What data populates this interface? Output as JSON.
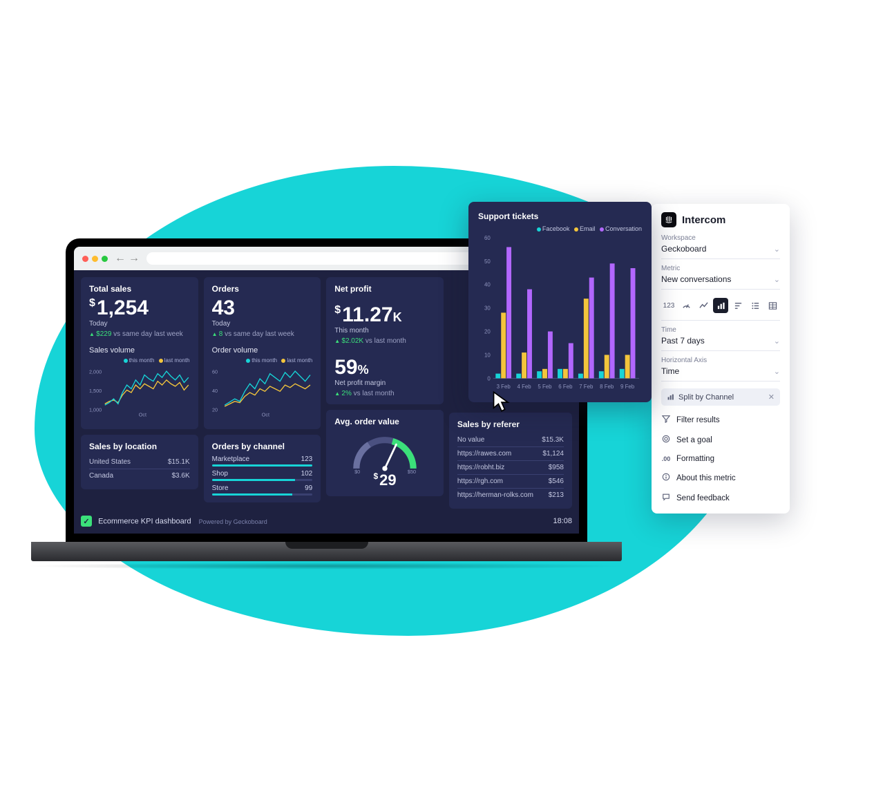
{
  "dashboard": {
    "title": "Ecommerce KPI dashboard",
    "powered_by": "Powered by Geckoboard",
    "clock": "18:08"
  },
  "total_sales": {
    "title": "Total sales",
    "currency": "$",
    "value": "1,254",
    "period": "Today",
    "delta_val": "$229",
    "delta_txt": "vs same day last week",
    "sub_title": "Sales volume",
    "ymax": "2,000",
    "ymid": "1,500",
    "ymin": "1,000",
    "xlabel": "Oct",
    "legend_a": "this month",
    "legend_b": "last month"
  },
  "orders": {
    "title": "Orders",
    "value": "43",
    "period": "Today",
    "delta_val": "8",
    "delta_txt": "vs same day last week",
    "sub_title": "Order volume",
    "ymax": "60",
    "ymid": "40",
    "ymin": "20",
    "xlabel": "Oct",
    "legend_a": "this month",
    "legend_b": "last month",
    "channels_title": "Orders by channel",
    "channels": [
      {
        "label": "Marketplace",
        "value": "123",
        "pct": 100
      },
      {
        "label": "Shop",
        "value": "102",
        "pct": 83
      },
      {
        "label": "Store",
        "value": "99",
        "pct": 80
      }
    ]
  },
  "net_profit": {
    "title": "Net profit",
    "currency": "$",
    "value": "11.27",
    "suffix": "K",
    "period": "This month",
    "delta_val": "$2.02K",
    "delta_txt": "vs last month",
    "margin_value": "59",
    "margin_suffix": "%",
    "margin_label": "Net profit margin",
    "margin_delta_val": "2%",
    "margin_delta_txt": "vs last month"
  },
  "avg_order": {
    "title": "Avg. order value",
    "min": "$0",
    "max": "$50",
    "currency": "$",
    "value": "29"
  },
  "sales_by_location": {
    "title": "Sales by location",
    "rows": [
      {
        "label": "United States",
        "value": "$15.1K"
      },
      {
        "label": "Canada",
        "value": "$3.6K"
      }
    ]
  },
  "sales_by_referer": {
    "title": "Sales by referer",
    "rows": [
      {
        "label": "No value",
        "value": "$15.3K"
      },
      {
        "label": "https://rawes.com",
        "value": "$1,124"
      },
      {
        "label": "https://robht.biz",
        "value": "$958"
      },
      {
        "label": "https://rgh.com",
        "value": "$546"
      },
      {
        "label": "https://herman-rolks.com",
        "value": "$213"
      }
    ]
  },
  "support_tickets": {
    "title": "Support tickets",
    "legend": {
      "a": "Facebook",
      "b": "Email",
      "c": "Conversation"
    },
    "ylabels": [
      "0",
      "10",
      "20",
      "30",
      "40",
      "50",
      "60"
    ]
  },
  "panel": {
    "brand": "Intercom",
    "workspace_lbl": "Workspace",
    "workspace_val": "Geckoboard",
    "metric_lbl": "Metric",
    "metric_val": "New conversations",
    "viz_number": "123",
    "time_lbl": "Time",
    "time_val": "Past 7 days",
    "haxis_lbl": "Horizontal Axis",
    "haxis_val": "Time",
    "chip": "Split by Channel",
    "links": {
      "filter": "Filter results",
      "goal": "Set a goal",
      "format": "Formatting",
      "about": "About this metric",
      "feedback": "Send feedback"
    },
    "fmt_icon": ".00"
  },
  "chart_data": [
    {
      "id": "support_tickets",
      "type": "bar",
      "title": "Support tickets",
      "categories": [
        "3 Feb",
        "4 Feb",
        "5 Feb",
        "6 Feb",
        "7 Feb",
        "8 Feb",
        "9 Feb"
      ],
      "series": [
        {
          "name": "Facebook",
          "color": "#17d4d7",
          "values": [
            2,
            2,
            3,
            4,
            2,
            3,
            4
          ]
        },
        {
          "name": "Email",
          "color": "#f3c53c",
          "values": [
            28,
            11,
            4,
            4,
            34,
            10,
            10
          ]
        },
        {
          "name": "Conversation",
          "color": "#b267ff",
          "values": [
            56,
            38,
            20,
            15,
            43,
            49,
            47
          ]
        }
      ],
      "ylim": [
        0,
        60
      ],
      "yticks": [
        0,
        10,
        20,
        30,
        40,
        50,
        60
      ]
    },
    {
      "id": "sales_volume",
      "type": "line",
      "title": "Sales volume",
      "xlabel": "Oct",
      "ylim": [
        1000,
        2000
      ],
      "yticks": [
        1000,
        1500,
        2000
      ],
      "series": [
        {
          "name": "this month",
          "color": "#17d4d7",
          "values": [
            1200,
            1250,
            1300,
            1180,
            1400,
            1550,
            1480,
            1600,
            1520,
            1700,
            1650,
            1600,
            1750,
            1680,
            1800,
            1720,
            1650,
            1780,
            1600,
            1720,
            1690,
            1740,
            1680,
            1620,
            1700,
            1590,
            1640,
            1720
          ]
        },
        {
          "name": "last month",
          "color": "#f3c53c",
          "values": [
            1180,
            1220,
            1260,
            1240,
            1350,
            1420,
            1380,
            1500,
            1460,
            1550,
            1520,
            1480,
            1600,
            1560,
            1620,
            1580,
            1540,
            1610,
            1500,
            1580,
            1560,
            1600,
            1550,
            1520,
            1580,
            1500,
            1550,
            1620
          ]
        }
      ]
    },
    {
      "id": "order_volume",
      "type": "line",
      "title": "Order volume",
      "xlabel": "Oct",
      "ylim": [
        20,
        60
      ],
      "yticks": [
        20,
        40,
        60
      ],
      "series": [
        {
          "name": "this month",
          "color": "#17d4d7",
          "values": [
            28,
            30,
            32,
            29,
            38,
            44,
            40,
            46,
            42,
            50,
            48,
            46,
            52,
            48,
            54,
            50,
            46,
            52,
            44,
            50,
            48,
            50,
            46,
            44,
            48,
            42,
            45,
            50
          ]
        },
        {
          "name": "last month",
          "color": "#f3c53c",
          "values": [
            26,
            28,
            30,
            29,
            34,
            38,
            36,
            42,
            40,
            44,
            42,
            40,
            46,
            44,
            46,
            44,
            42,
            46,
            40,
            44,
            42,
            44,
            42,
            40,
            44,
            40,
            42,
            46
          ]
        }
      ]
    },
    {
      "id": "orders_by_channel",
      "type": "bar",
      "title": "Orders by channel",
      "categories": [
        "Marketplace",
        "Shop",
        "Store"
      ],
      "values": [
        123,
        102,
        99
      ]
    },
    {
      "id": "avg_order_value",
      "type": "gauge",
      "title": "Avg. order value",
      "value": 29,
      "min": 0,
      "max": 50
    },
    {
      "id": "sales_by_location",
      "type": "table",
      "title": "Sales by location",
      "rows": [
        [
          "United States",
          "$15.1K"
        ],
        [
          "Canada",
          "$3.6K"
        ]
      ]
    },
    {
      "id": "sales_by_referer",
      "type": "table",
      "title": "Sales by referer",
      "rows": [
        [
          "No value",
          "$15.3K"
        ],
        [
          "https://rawes.com",
          "$1,124"
        ],
        [
          "https://robht.biz",
          "$958"
        ],
        [
          "https://rgh.com",
          "$546"
        ],
        [
          "https://herman-rolks.com",
          "$213"
        ]
      ]
    }
  ]
}
